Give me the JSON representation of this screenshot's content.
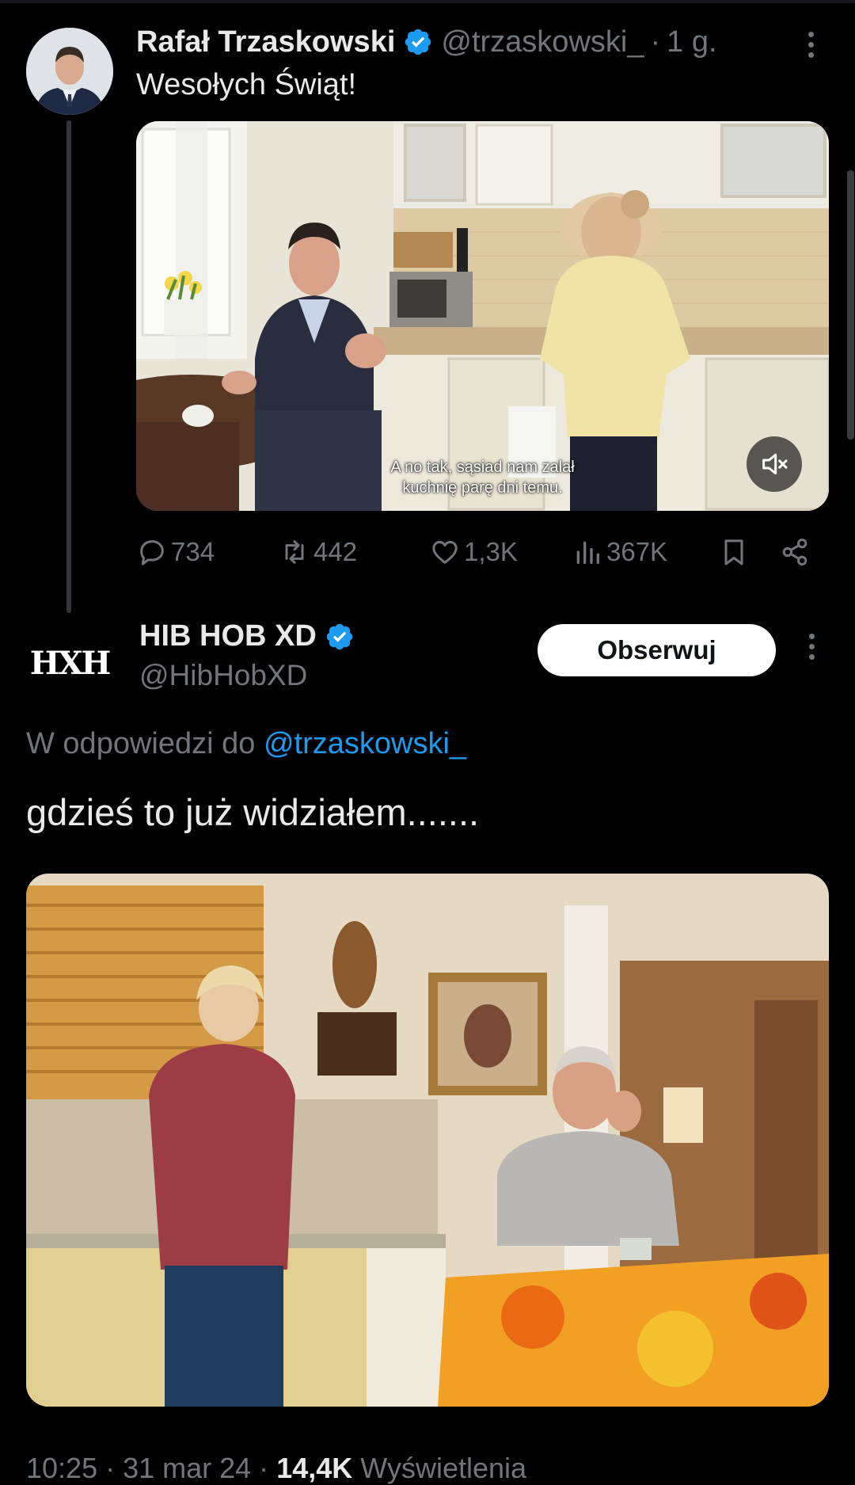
{
  "colors": {
    "background": "#000000",
    "text": "#e7e9ea",
    "muted": "#71767b",
    "accent": "#1d9bf0"
  },
  "tweet1": {
    "author_name": "Rafał Trzaskowski",
    "handle": "@trzaskowski_",
    "separator": "·",
    "time": "1 g.",
    "text": "Wesołych Świąt!",
    "video_subtitle_line1": "A no tak, sąsiad nam zalał",
    "video_subtitle_line2": "kuchnię parę dni temu.",
    "stats": {
      "replies": "734",
      "reposts": "442",
      "likes": "1,3K",
      "views": "367K"
    },
    "icons": [
      "verified-badge-icon",
      "more-icon",
      "mute-icon",
      "reply-icon",
      "repost-icon",
      "like-icon",
      "views-icon",
      "bookmark-icon",
      "share-icon"
    ]
  },
  "tweet2": {
    "author_name": "HIB HOB XD",
    "handle": "@HibHobXD",
    "avatar_text": "HXH",
    "follow_label": "Obserwuj",
    "reply_prefix": "W odpowiedzi do",
    "reply_mention": "@trzaskowski_",
    "text": "gdzieś to już widziałem.......",
    "meta_time": "10:25 · 31 mar 24 ·",
    "meta_views_count": "14,4K",
    "meta_views_label": "Wyświetlenia"
  }
}
